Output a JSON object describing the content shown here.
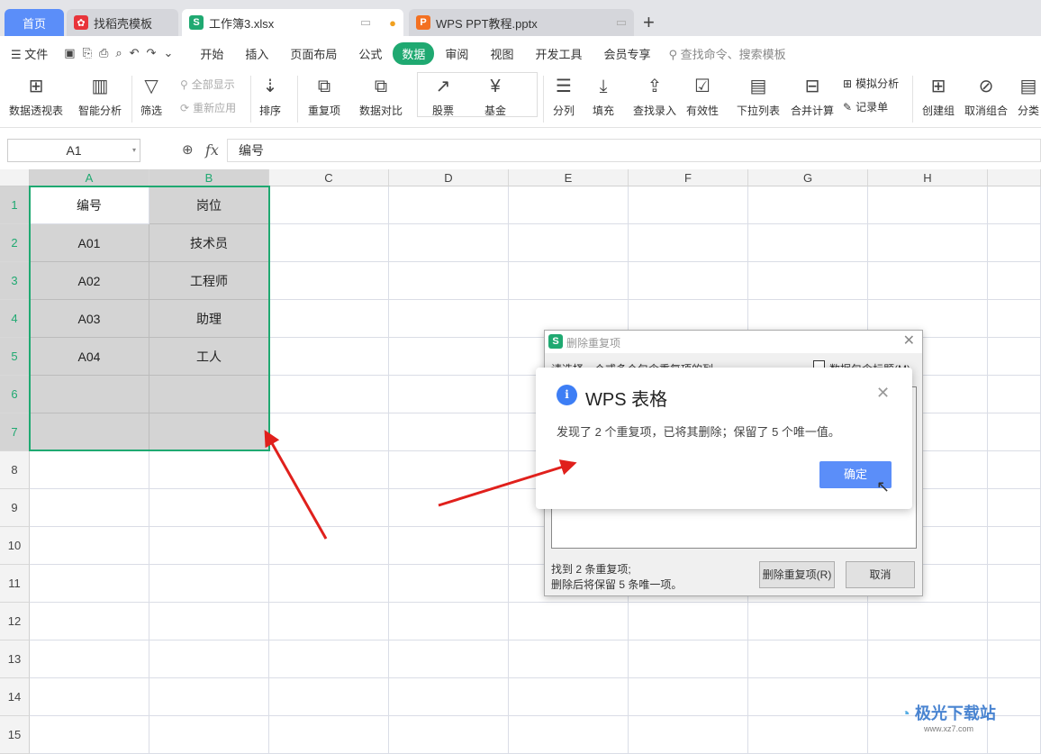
{
  "tabs": [
    {
      "label": "首页"
    },
    {
      "label": "找稻壳模板"
    },
    {
      "label": "工作簿3.xlsx"
    },
    {
      "label": "WPS PPT教程.pptx"
    }
  ],
  "new_tab": "+",
  "menu": {
    "file": "文件",
    "items": [
      "开始",
      "插入",
      "页面布局",
      "公式",
      "数据",
      "审阅",
      "视图",
      "开发工具",
      "会员专享"
    ],
    "active": "数据",
    "search_placeholder": "查找命令、搜索模板"
  },
  "ribbon": {
    "pivot": "数据透视表",
    "smart": "智能分析",
    "filter": "筛选",
    "show_all": "全部显示",
    "reapply": "重新应用",
    "sort": "排序",
    "dup": "重复项",
    "compare": "数据对比",
    "stock": "股票",
    "fund": "基金",
    "split": "分列",
    "fill": "填充",
    "lookup": "查找录入",
    "valid": "有效性",
    "dropdown": "下拉列表",
    "consolidate": "合并计算",
    "whatif": "模拟分析",
    "form": "记录单",
    "group": "创建组",
    "ungroup": "取消组合",
    "subtotal": "分类"
  },
  "formula": {
    "cell_ref": "A1",
    "fx": "fx",
    "value": "编号"
  },
  "columns": [
    "A",
    "B",
    "C",
    "D",
    "E",
    "F",
    "G",
    "H"
  ],
  "rows": [
    "1",
    "2",
    "3",
    "4",
    "5",
    "6",
    "7",
    "8",
    "9",
    "10",
    "11",
    "12",
    "13",
    "14",
    "15"
  ],
  "cells": [
    [
      "编号",
      "岗位"
    ],
    [
      "A01",
      "技术员"
    ],
    [
      "A02",
      "工程师"
    ],
    [
      "A03",
      "助理"
    ],
    [
      "A04",
      "工人"
    ],
    [
      "",
      ""
    ],
    [
      "",
      ""
    ]
  ],
  "dedupe_dialog": {
    "title": "删除重复项",
    "prompt": "请选择一个或多个包含重复项的列",
    "header_checkbox": "数据包含标题(M)",
    "header_checked": false,
    "status_line1": "找到 2 条重复项;",
    "status_line2": "删除后将保留 5 条唯一项。",
    "delete_button": "删除重复项(R)",
    "cancel_button": "取消"
  },
  "message_box": {
    "title": "WPS 表格",
    "message": "发现了 2 个重复项，已将其删除；保留了 5 个唯一值。",
    "ok_button": "确定"
  },
  "watermark": "极光下载站 www.xz7.com",
  "colors": {
    "accent": "#1fa971",
    "selection_border": "#1fa971",
    "ok_button": "#5b8ef9",
    "arrow": "#e0201c"
  }
}
